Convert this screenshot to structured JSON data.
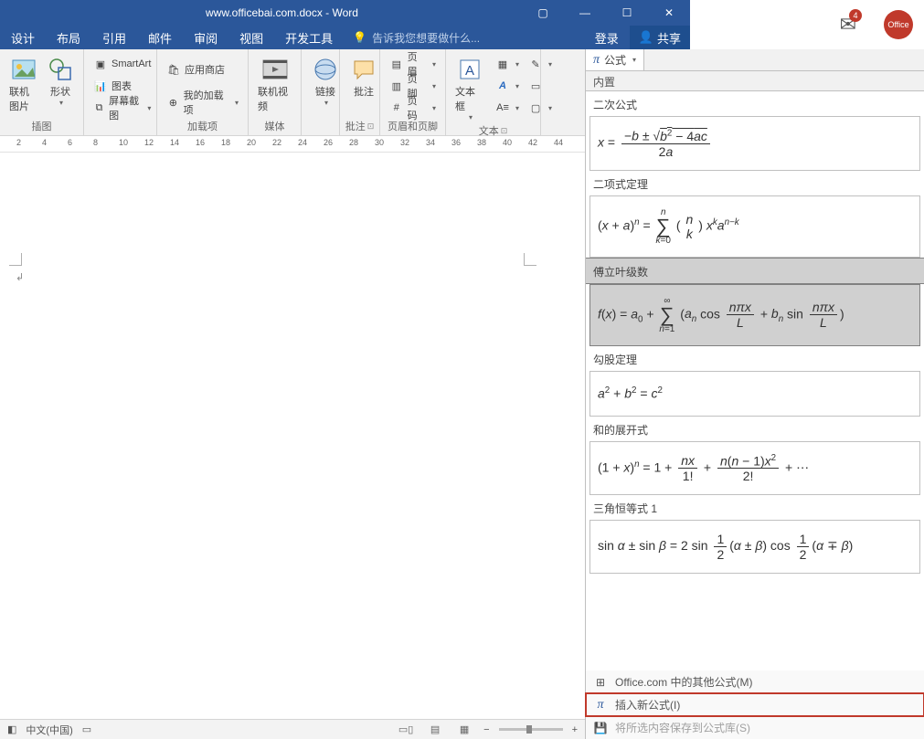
{
  "title": "www.officebai.com.docx - Word",
  "tabs": {
    "design": "设计",
    "layout": "布局",
    "references": "引用",
    "mailings": "邮件",
    "review": "审阅",
    "view": "视图",
    "dev": "开发工具"
  },
  "tell_me": "告诉我您想要做什么...",
  "login": "登录",
  "share": "共享",
  "ribbon": {
    "smartart": "SmartArt",
    "chart": "图表",
    "screenshot": "屏幕截图",
    "online_pic": "联机图片",
    "shapes": "形状",
    "store": "应用商店",
    "my_addins": "我的加载项",
    "online_video": "联机视频",
    "links": "链接",
    "comment": "批注",
    "header": "页眉",
    "footer": "页脚",
    "page_no": "页码",
    "textbox": "文本框",
    "grp_illus": "插图",
    "grp_addins": "加载项",
    "grp_media": "媒体",
    "grp_comments": "批注",
    "grp_hf": "页眉和页脚",
    "grp_text": "文本"
  },
  "ruler_ticks": [
    2,
    4,
    6,
    8,
    10,
    12,
    14,
    16,
    18,
    20,
    22,
    24,
    26,
    28,
    30,
    32,
    34,
    36,
    38,
    40,
    42,
    44
  ],
  "status": {
    "lang": "中文(中国)"
  },
  "equation": {
    "btn": "公式",
    "builtin": "内置",
    "quadratic": "二次公式",
    "binomial": "二项式定理",
    "fourier": "傅立叶级数",
    "pythag": "勾股定理",
    "expand": "和的展开式",
    "trig": "三角恒等式 1",
    "office_more": "Office.com 中的其他公式(M)",
    "insert_new": "插入新公式(I)",
    "save_sel": "将所选内容保存到公式库(S)"
  },
  "notif": {
    "count": "4",
    "office": "Office"
  }
}
